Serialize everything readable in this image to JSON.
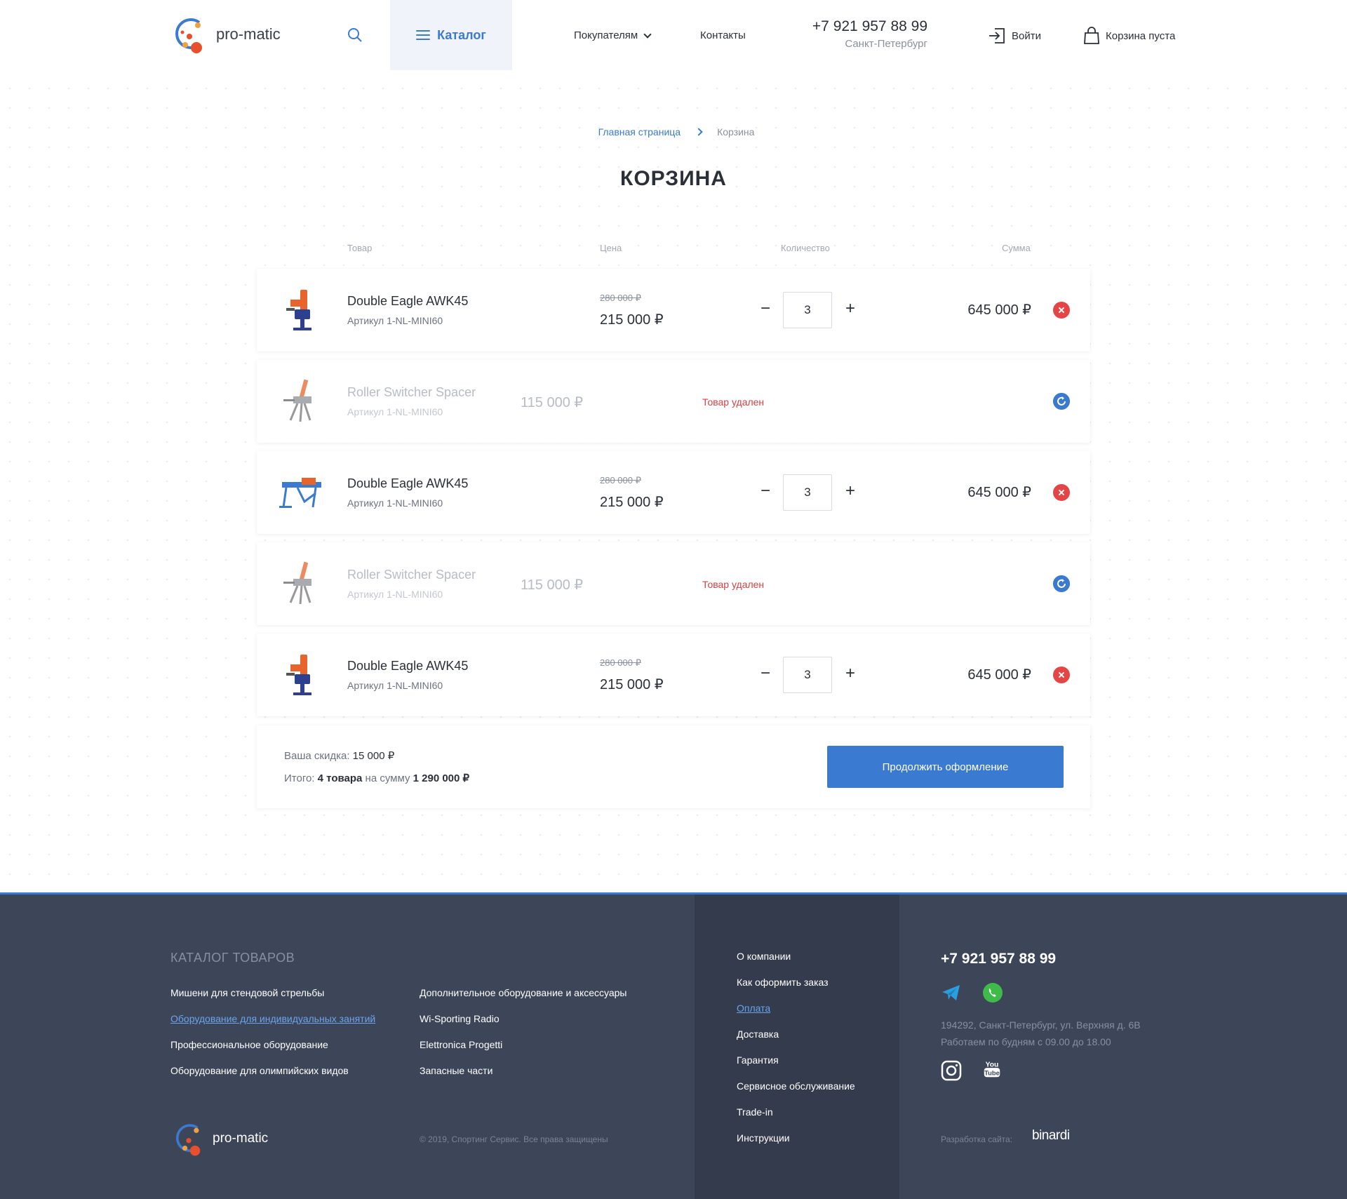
{
  "header": {
    "logo_text": "pro-matic",
    "catalog_label": "Каталог",
    "nav_buyers": "Покупателям",
    "nav_contacts": "Контакты",
    "phone": "+7 921 957 88 99",
    "city": "Санкт-Петербург",
    "login_label": "Войти",
    "cart_label": "Корзина пуста"
  },
  "breadcrumb": {
    "home": "Главная страница",
    "current": "Корзина"
  },
  "page_title": "КОРЗИНА",
  "columns": {
    "product": "Товар",
    "price": "Цена",
    "qty": "Количество",
    "sum": "Сумма"
  },
  "items": [
    {
      "name": "Double Eagle AWK45",
      "sku": "Артикул 1-NL-MINI60",
      "old_price": "280 000 ₽",
      "price": "215 000 ₽",
      "qty": "3",
      "sum": "645 000 ₽"
    },
    {
      "name": "Roller Switcher Spacer",
      "sku": "Артикул 1-NL-MINI60",
      "price": "115 000 ₽",
      "status": "Товар удален"
    },
    {
      "name": "Double Eagle AWK45",
      "sku": "Артикул 1-NL-MINI60",
      "old_price": "280 000 ₽",
      "price": "215 000 ₽",
      "qty": "3",
      "sum": "645 000 ₽"
    },
    {
      "name": "Roller Switcher Spacer",
      "sku": "Артикул 1-NL-MINI60",
      "price": "115 000 ₽",
      "status": "Товар удален"
    },
    {
      "name": "Double Eagle AWK45",
      "sku": "Артикул 1-NL-MINI60",
      "old_price": "280 000 ₽",
      "price": "215 000 ₽",
      "qty": "3",
      "sum": "645 000 ₽"
    }
  ],
  "summary": {
    "discount_label": "Ваша скидка:",
    "discount_value": "15 000 ₽",
    "total_label": "Итого:",
    "total_count": "4 товара",
    "total_mid": "на сумму",
    "total_value": "1 290 000 ₽",
    "continue_label": "Продолжить оформление"
  },
  "footer": {
    "catalog_heading": "КАТАЛОГ ТОВАРОВ",
    "catalog_col1": [
      "Мишени для стендовой стрельбы",
      "Оборудование для индивидуальных занятий",
      "Профессиональное оборудование",
      "Оборудование для олимпийских видов"
    ],
    "catalog_col2": [
      "Дополнительное оборудование и аксессуары",
      "Wi-Sporting Radio",
      "Elettronica Progetti",
      "Запасные части"
    ],
    "info_links": [
      "О компании",
      "Как оформить заказ",
      "Оплата",
      "Доставка",
      "Гарантия",
      "Сервисное обслуживание",
      "Trade-in",
      "Инструкции"
    ],
    "phone": "+7 921 957 88 99",
    "address": "194292, Санкт-Петербург, ул. Верхняя д. 6В",
    "hours": "Работаем по будням с 09.00 до 18.00",
    "copyright": "© 2019, Спортинг Сервис. Все права защищены",
    "logo_text": "pro-matic",
    "dev_label": "Разработка сайта:",
    "dev_name": "binardi",
    "youtube_text_top": "You",
    "youtube_text_bottom": "Tube"
  },
  "colors": {
    "accent": "#3a7ad0",
    "remove": "#e54545",
    "deleted_text": "#d64141",
    "footer_bg": "#3d4558"
  }
}
